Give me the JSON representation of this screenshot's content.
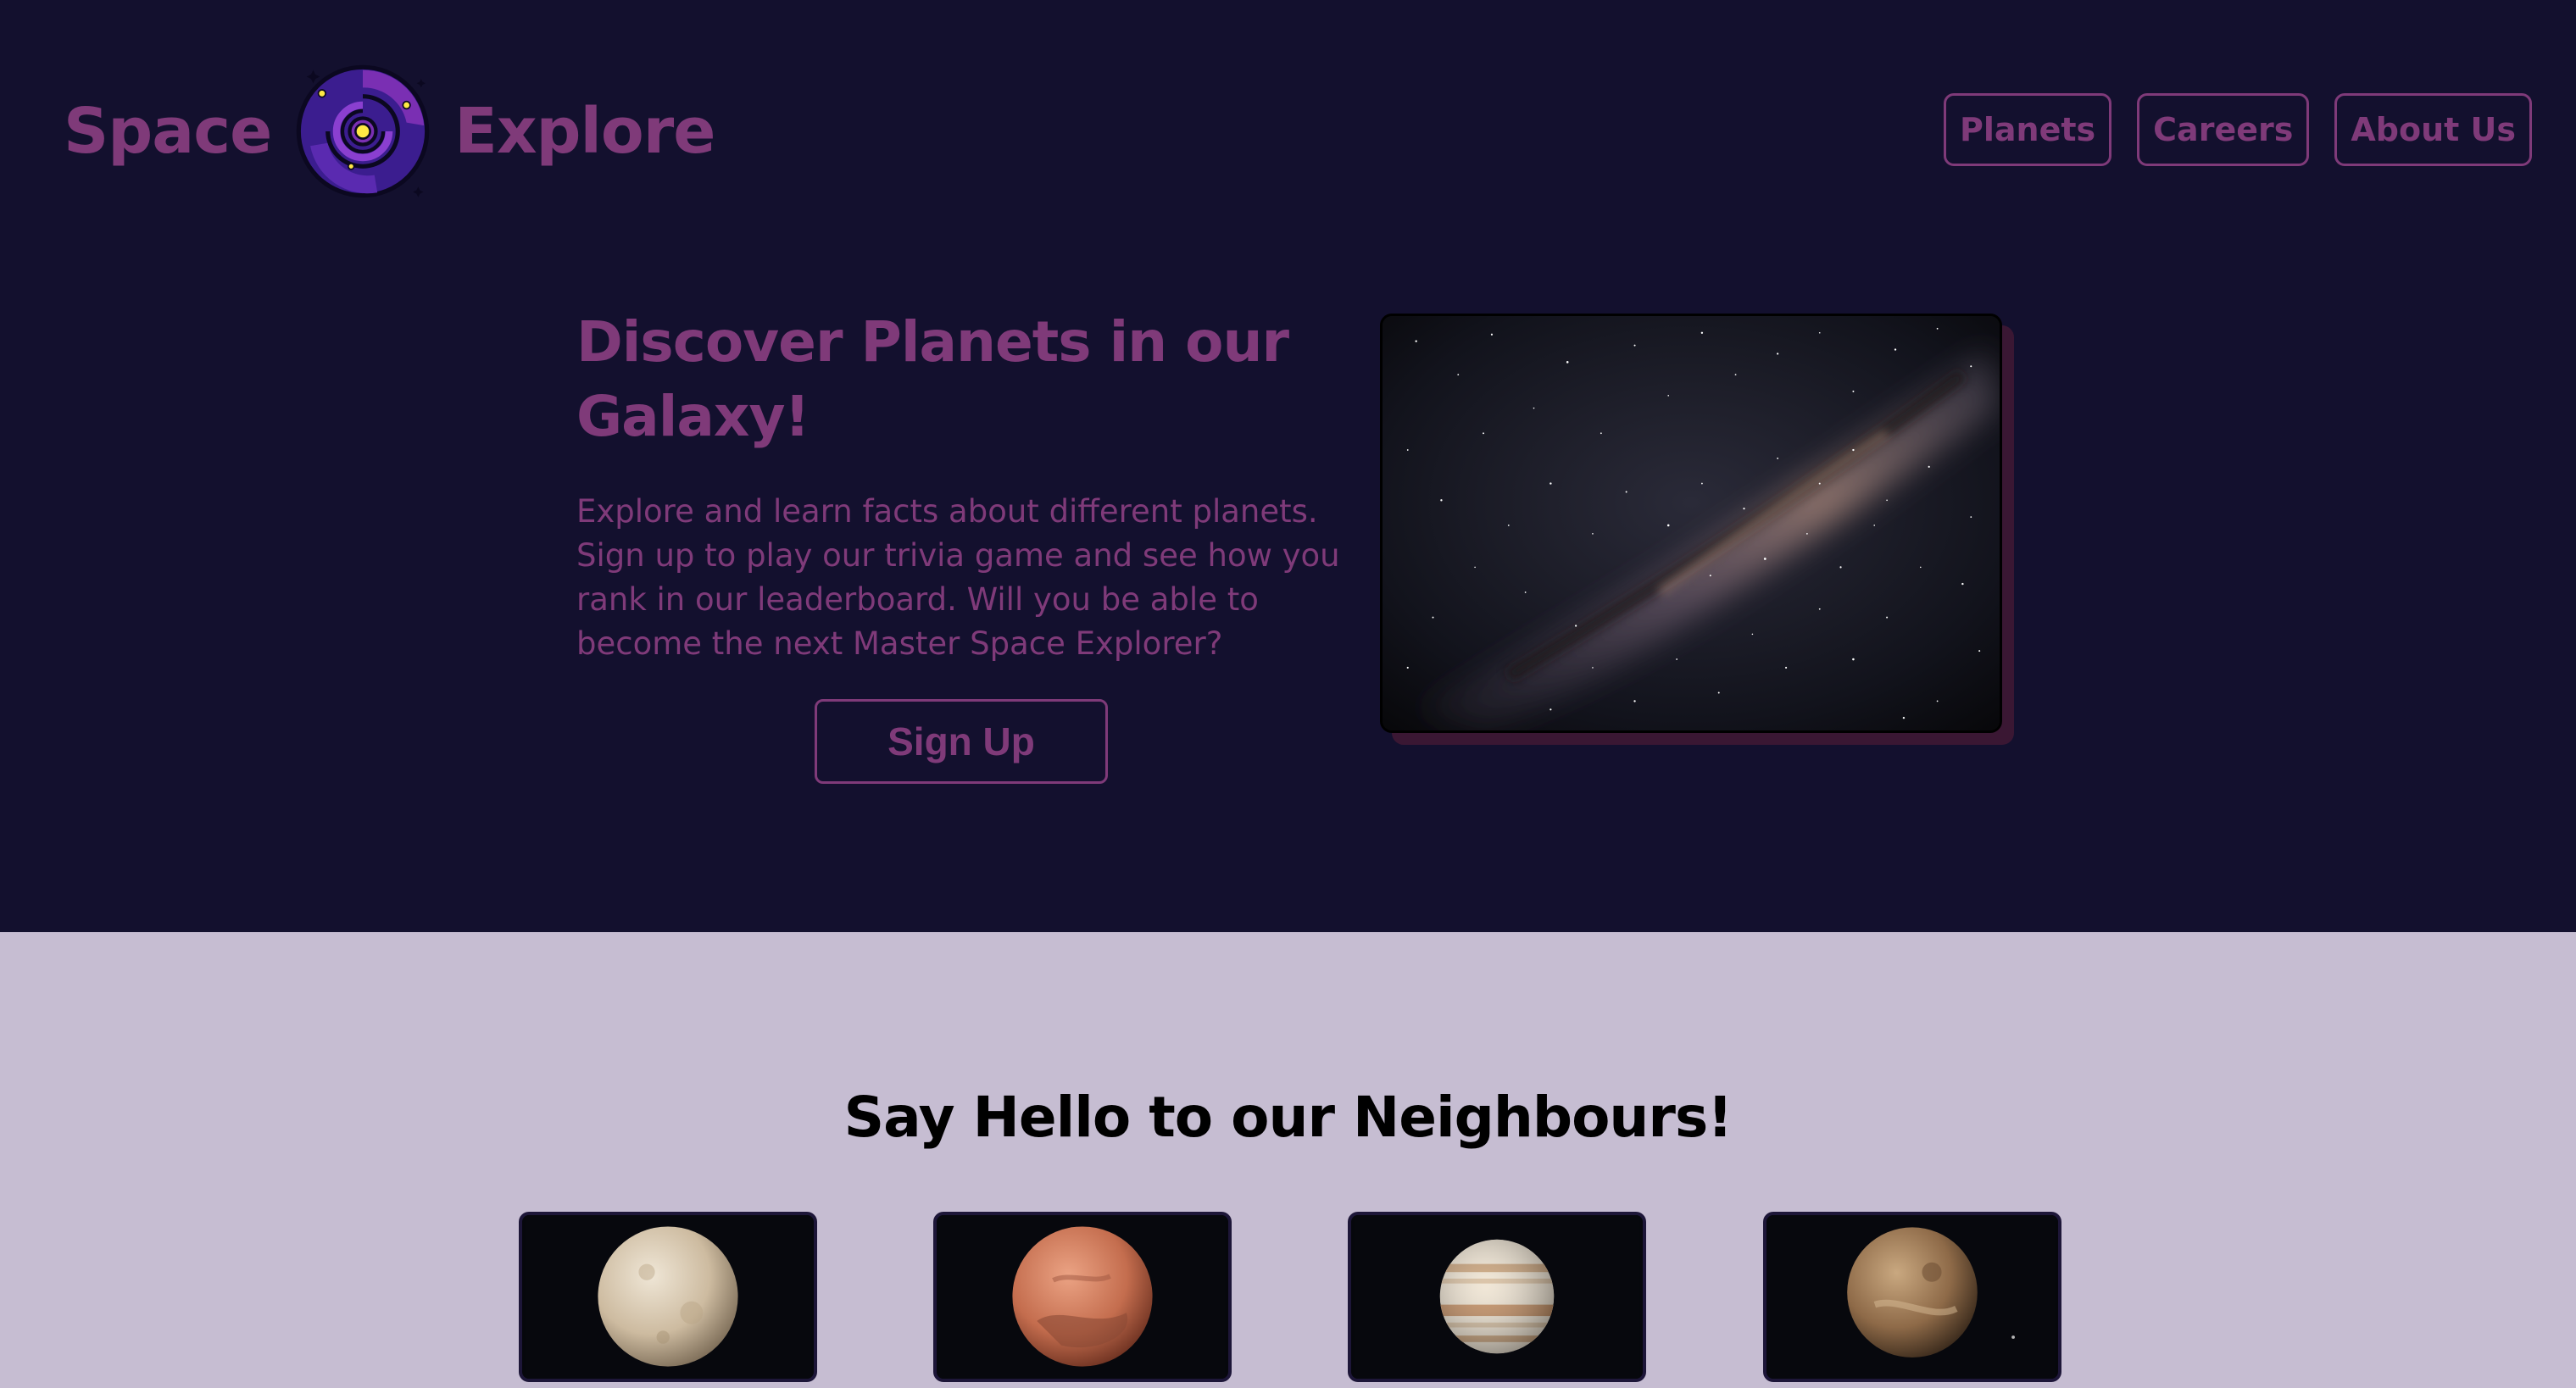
{
  "brand": {
    "word1": "Space",
    "word2": "Explore",
    "logo_icon": "galaxy-spiral-icon"
  },
  "nav": {
    "items": [
      {
        "label": "Planets"
      },
      {
        "label": "Careers"
      },
      {
        "label": "About Us"
      }
    ]
  },
  "hero": {
    "title": "Discover Planets in our Galaxy!",
    "description": "Explore and learn facts about different planets. Sign up to play our trivia game and see how you rank in our leaderboard. Will you be able to become the next Master Space Explorer?",
    "cta_label": "Sign Up",
    "image": "milky-way-image"
  },
  "neighbours": {
    "title": "Say Hello to our Neighbours!",
    "planets": [
      {
        "image": "mercury-image"
      },
      {
        "image": "mars-image"
      },
      {
        "image": "jupiter-image"
      },
      {
        "image": "pluto-image"
      }
    ]
  },
  "colors": {
    "header_bg": "#13102e",
    "accent": "#7f3a79",
    "section_bg": "#c6bdd2",
    "card_border": "#1d1638"
  }
}
